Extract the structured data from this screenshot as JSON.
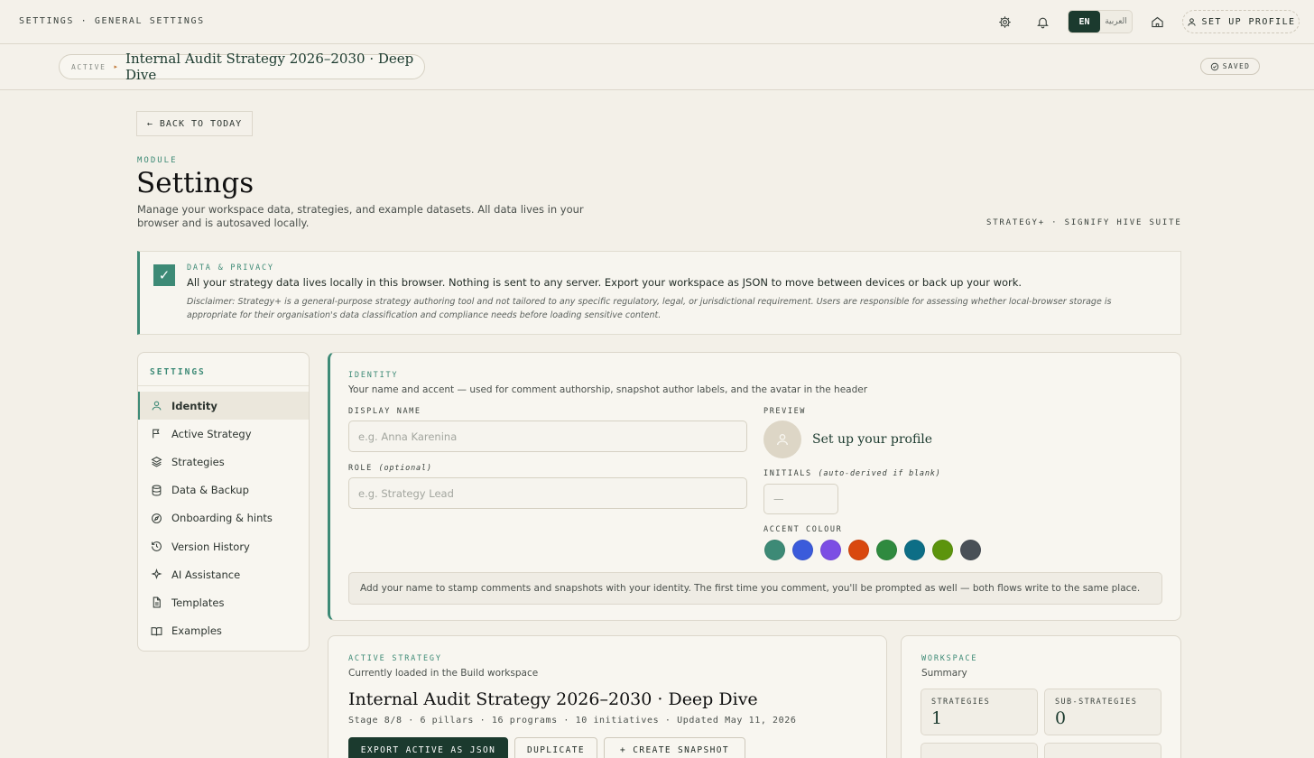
{
  "topbar": {
    "breadcrumb": "SETTINGS · GENERAL SETTINGS",
    "lang_en": "EN",
    "lang_ar": "العربية",
    "profile_label": "SET UP PROFILE"
  },
  "subbar": {
    "active_tag": "ACTIVE",
    "strategy_name": "Internal Audit Strategy 2026–2030 · Deep Dive",
    "saved_label": "SAVED"
  },
  "header": {
    "back_label": "← BACK TO TODAY",
    "module_tag": "MODULE",
    "title": "Settings",
    "description": "Manage your workspace data, strategies, and example datasets. All data lives in your browser and is autosaved locally.",
    "suite": "STRATEGY+ · SIGNIFY HIVE SUITE"
  },
  "privacy": {
    "tag": "DATA & PRIVACY",
    "main": "All your strategy data lives locally in this browser. Nothing is sent to any server. Export your workspace as JSON to move between devices or back up your work.",
    "disclaimer": "Disclaimer: Strategy+ is a general-purpose strategy authoring tool and not tailored to any specific regulatory, legal, or jurisdictional requirement. Users are responsible for assessing whether local-browser storage is appropriate for their organisation's data classification and compliance needs before loading sensitive content."
  },
  "sidebar": {
    "title": "SETTINGS",
    "items": [
      {
        "label": "Identity",
        "icon": "user-icon"
      },
      {
        "label": "Active Strategy",
        "icon": "flag-icon"
      },
      {
        "label": "Strategies",
        "icon": "layers-icon"
      },
      {
        "label": "Data & Backup",
        "icon": "database-icon"
      },
      {
        "label": "Onboarding & hints",
        "icon": "compass-icon"
      },
      {
        "label": "Version History",
        "icon": "history-icon"
      },
      {
        "label": "AI Assistance",
        "icon": "sparkle-icon"
      },
      {
        "label": "Templates",
        "icon": "file-icon"
      },
      {
        "label": "Examples",
        "icon": "book-icon"
      }
    ]
  },
  "identity": {
    "tag": "IDENTITY",
    "subtitle": "Your name and accent — used for comment authorship, snapshot author labels, and the avatar in the header",
    "display_name_label": "DISPLAY NAME",
    "display_name_placeholder": "e.g. Anna Karenina",
    "role_label": "ROLE",
    "role_optional": "(optional)",
    "role_placeholder": "e.g. Strategy Lead",
    "preview_label": "PREVIEW",
    "preview_name": "Set up your profile",
    "initials_label": "INITIALS",
    "initials_hint": "(auto-derived if blank)",
    "initials_placeholder": "—",
    "accent_label": "ACCENT COLOUR",
    "accent_colors": [
      "#3d8a76",
      "#3b5bdb",
      "#7c4ee4",
      "#d9480f",
      "#2f8a3f",
      "#0d6e86",
      "#5c940d",
      "#495057"
    ],
    "hint": "Add your name to stamp comments and snapshots with your identity. The first time you comment, you'll be prompted as well — both flows write to the same place."
  },
  "active_strategy": {
    "tag": "ACTIVE STRATEGY",
    "subtitle": "Currently loaded in the Build workspace",
    "title": "Internal Audit Strategy 2026–2030 · Deep Dive",
    "meta": "Stage 8/8 · 6 pillars · 16 programs · 10 initiatives · Updated May 11, 2026",
    "export_label": "EXPORT ACTIVE AS JSON",
    "duplicate_label": "DUPLICATE",
    "snapshot_label": "+ CREATE SNAPSHOT"
  },
  "workspace": {
    "tag": "WORKSPACE",
    "subtitle": "Summary",
    "stats": [
      {
        "label": "STRATEGIES",
        "value": "1"
      },
      {
        "label": "SUB-STRATEGIES",
        "value": "0"
      }
    ]
  }
}
